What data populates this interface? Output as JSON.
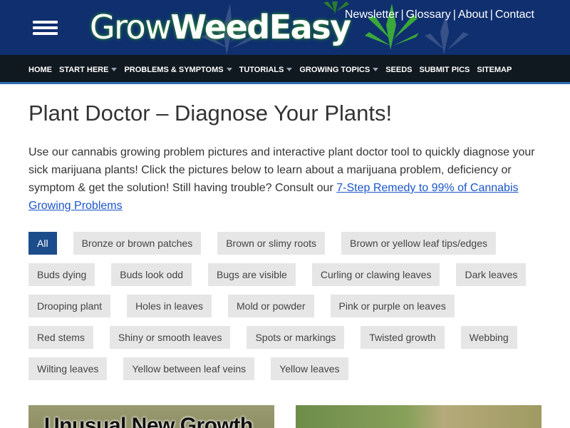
{
  "header": {
    "logo": {
      "part1": "Grow",
      "part2": "WeedEasy"
    },
    "top_links": [
      "Newsletter",
      "Glossary",
      "About",
      "Contact"
    ],
    "colors": {
      "background": "#0f2f6f",
      "leaf": "#3aa83a"
    }
  },
  "nav": {
    "items": [
      {
        "label": "HOME",
        "dropdown": false
      },
      {
        "label": "START HERE",
        "dropdown": true
      },
      {
        "label": "PROBLEMS & SYMPTOMS",
        "dropdown": true
      },
      {
        "label": "TUTORIALS",
        "dropdown": true
      },
      {
        "label": "GROWING TOPICS",
        "dropdown": true
      },
      {
        "label": "SEEDS",
        "dropdown": false
      },
      {
        "label": "SUBMIT PICS",
        "dropdown": false
      },
      {
        "label": "SITEMAP",
        "dropdown": false
      }
    ],
    "colors": {
      "background": "#101820",
      "accent": "#2c6eb5"
    }
  },
  "main": {
    "title": "Plant Doctor – Diagnose Your Plants!",
    "intro_text": "Use our cannabis growing problem pictures and interactive plant doctor tool to quickly diagnose your sick marijuana plants! Click the pictures below to learn about a marijuana problem, deficiency or symptom & get the solution! Still having trouble? Consult our ",
    "intro_link": "7-Step Remedy to 99% of Cannabis Growing Problems",
    "filters": [
      "All",
      "Bronze or brown patches",
      "Brown or slimy roots",
      "Brown or yellow leaf tips/edges",
      "Buds dying",
      "Buds look odd",
      "Bugs are visible",
      "Curling or clawing leaves",
      "Dark leaves",
      "Drooping plant",
      "Holes in leaves",
      "Mold or powder",
      "Pink or purple on leaves",
      "Red stems",
      "Shiny or smooth leaves",
      "Spots or markings",
      "Twisted growth",
      "Webbing",
      "Wilting leaves",
      "Yellow between leaf veins",
      "Yellow leaves"
    ],
    "active_filter": "All",
    "colors": {
      "active_filter": "#1b4d8c",
      "filter": "#e6e6e6",
      "link": "#1a55c9"
    },
    "cards": [
      {
        "caption": "Unusual New Growth"
      },
      {
        "caption": ""
      }
    ]
  }
}
